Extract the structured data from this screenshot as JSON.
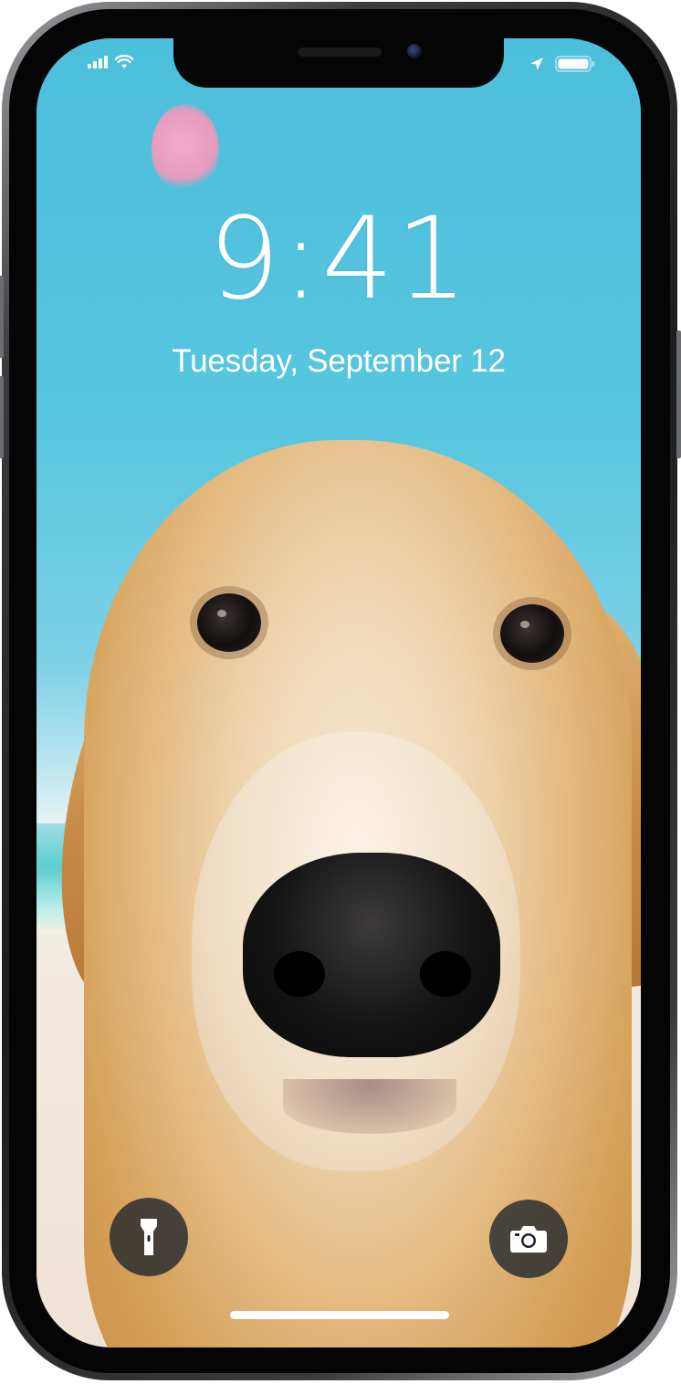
{
  "lock_screen": {
    "time": "9:41",
    "date": "Tuesday, September 12"
  },
  "status_bar": {
    "left_icons": [
      "signal-icon",
      "wifi-icon"
    ],
    "right_icons": [
      "location-arrow-icon",
      "battery-icon"
    ],
    "battery_level": 1.0
  },
  "quick_actions": {
    "left": "flashlight-icon",
    "right": "camera-icon"
  },
  "colors": {
    "text": "#ffffff",
    "button_bg": "#1b222d"
  }
}
